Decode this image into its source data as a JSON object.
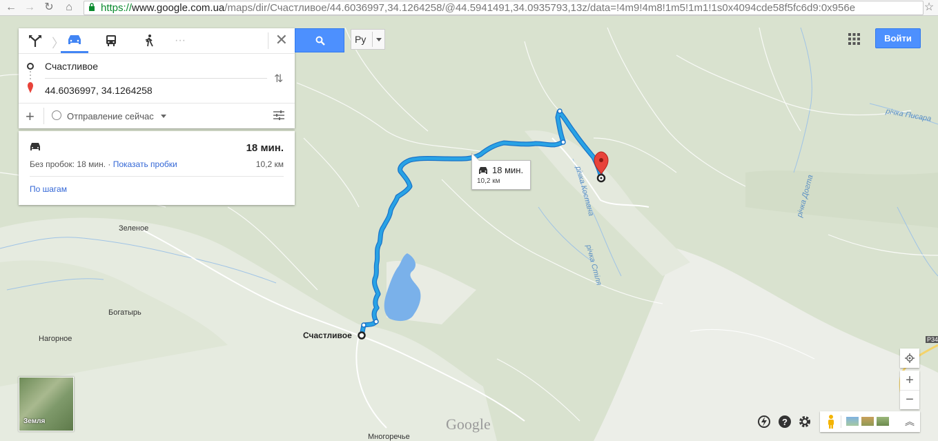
{
  "browser": {
    "url_protocol": "https://",
    "url_host": "www.google.com.ua",
    "url_path": "/maps/dir/Счастливое/44.6036997,34.1264258/@44.5941491,34.0935793,13z/data=!4m9!4m8!1m5!1m1!1s0x4094cde58f5fc6d9:0x956e"
  },
  "directions": {
    "origin": "Счастливое",
    "destination": "44.6036997, 34.1264258",
    "departure": "Отправление сейчас"
  },
  "route": {
    "time": "18 мин.",
    "traffic_text": "Без пробок: 18 мин. · ",
    "traffic_link": "Показать пробки",
    "distance": "10,2 км",
    "steps_link": "По шагам"
  },
  "bubble": {
    "time": "18 мин.",
    "distance": "10,2 км"
  },
  "header": {
    "language": "Ру",
    "signin": "Войти"
  },
  "map_labels": {
    "zelenoe": "Зеленое",
    "bogatyr": "Богатырь",
    "nagornoe": "Нагорное",
    "origin": "Счастливое",
    "mnogorechye": "Многоречье",
    "river_pisara": "річка Писара",
    "river_kostana": "річка Костана",
    "river_dohta": "річка Догта",
    "river_stilya": "річка Стіля",
    "road": "P34"
  },
  "earth": {
    "label": "Земля"
  },
  "logo": "Google",
  "colors": {
    "route": "#29a3e5",
    "route_outline": "#1a73c8",
    "accent": "#4d90fe",
    "pin": "#e8433a"
  }
}
